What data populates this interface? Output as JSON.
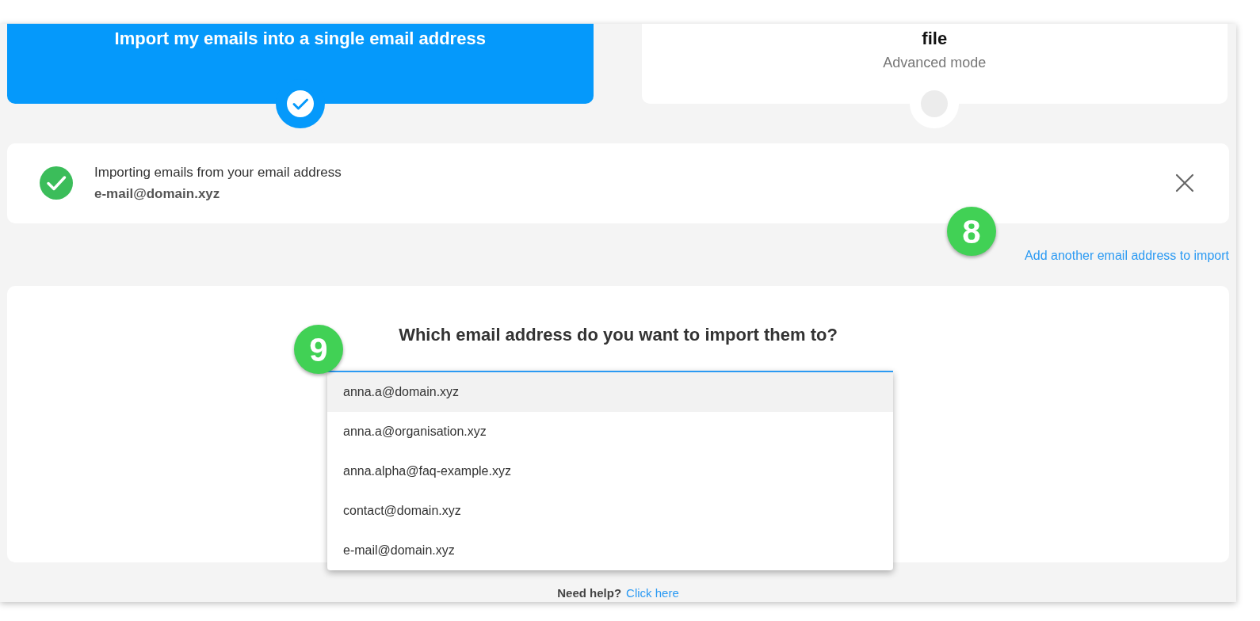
{
  "mode_cards": [
    {
      "title": "Import my emails into a single email address",
      "selected": true
    },
    {
      "title": "file",
      "subtitle": "Advanced mode",
      "selected": false
    }
  ],
  "import_source": {
    "label": "Importing emails from your email address",
    "address": "e-mail@domain.xyz"
  },
  "add_link": "Add another email address to import",
  "destination": {
    "question": "Which email address do you want to import them to?",
    "options": [
      {
        "label": "anna.a@domain.xyz",
        "highlighted": true
      },
      {
        "label": "anna.a@organisation.xyz",
        "highlighted": false
      },
      {
        "label": "anna.alpha@faq-example.xyz",
        "highlighted": false
      },
      {
        "label": "contact@domain.xyz",
        "highlighted": false
      },
      {
        "label": "e-mail@domain.xyz",
        "highlighted": false
      }
    ]
  },
  "callouts": [
    "8",
    "9"
  ],
  "help": {
    "text": "Need help?",
    "link": "Click here"
  }
}
